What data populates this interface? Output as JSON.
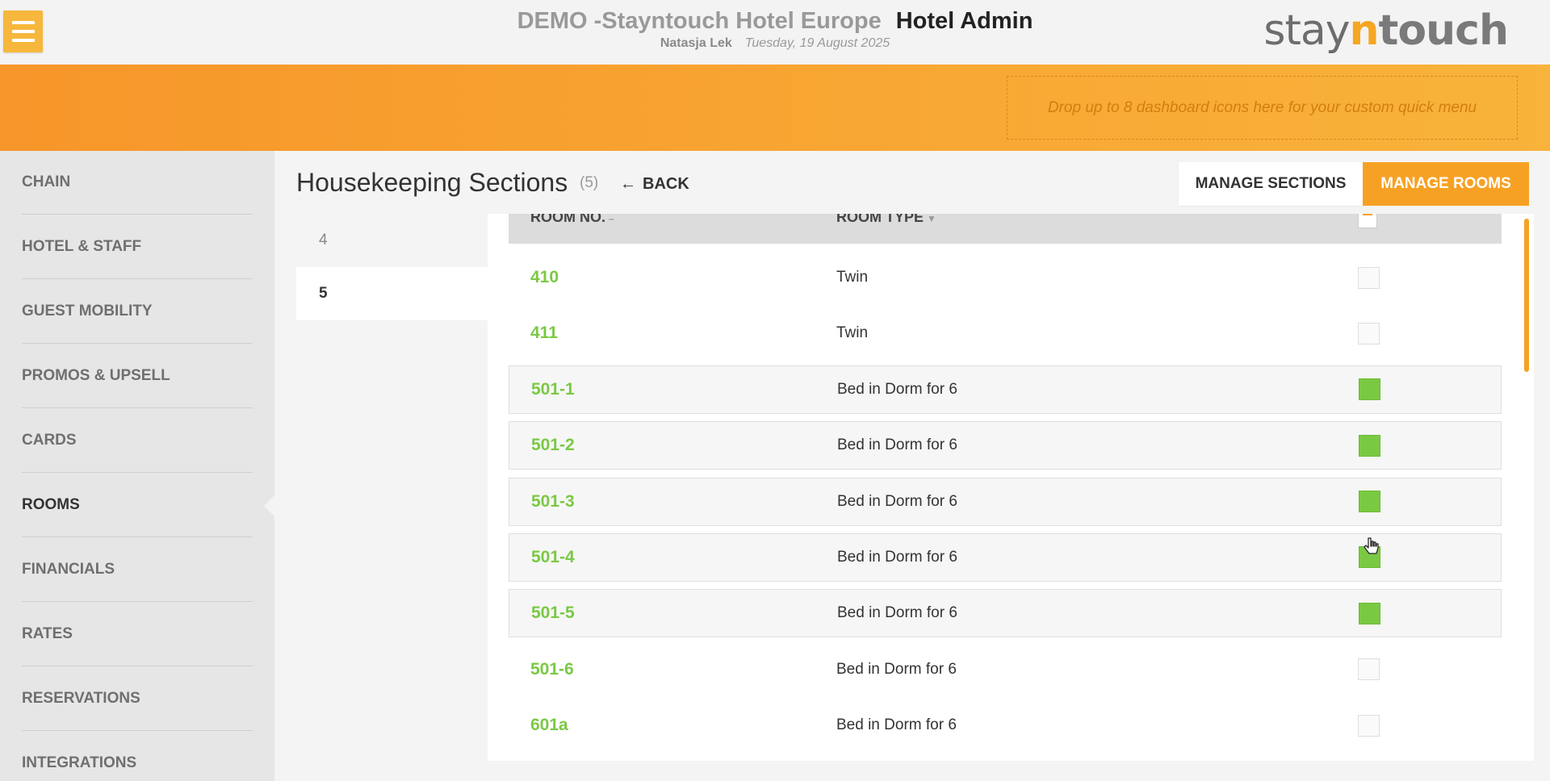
{
  "header": {
    "hotel_name": "DEMO -Stayntouch Hotel Europe",
    "app_title": "Hotel Admin",
    "user_name": "Natasja Lek",
    "date": "Tuesday, 19 August 2025",
    "logo": {
      "part1": "stay",
      "part2": "n",
      "part3": "touch"
    }
  },
  "banner": {
    "dropzone_text": "Drop up to 8 dashboard icons here for your custom quick menu"
  },
  "sidebar": {
    "items": [
      {
        "label": "CHAIN"
      },
      {
        "label": "HOTEL & STAFF"
      },
      {
        "label": "GUEST MOBILITY"
      },
      {
        "label": "PROMOS & UPSELL"
      },
      {
        "label": "CARDS"
      },
      {
        "label": "ROOMS",
        "active": true
      },
      {
        "label": "FINANCIALS"
      },
      {
        "label": "RATES"
      },
      {
        "label": "RESERVATIONS"
      },
      {
        "label": "INTEGRATIONS"
      }
    ]
  },
  "page": {
    "title": "Housekeeping Sections",
    "count": "(5)",
    "back_label": "BACK",
    "manage_sections_label": "MANAGE SECTIONS",
    "manage_rooms_label": "MANAGE ROOMS"
  },
  "sections": [
    {
      "label": "4",
      "active": false
    },
    {
      "label": "5",
      "active": true
    }
  ],
  "table": {
    "headers": {
      "room_no": "ROOM NO.",
      "room_type": "ROOM TYPE"
    },
    "rows": [
      {
        "room": "410",
        "type": "Twin",
        "checked": false
      },
      {
        "room": "411",
        "type": "Twin",
        "checked": false
      },
      {
        "room": "501-1",
        "type": "Bed in Dorm for 6",
        "checked": true
      },
      {
        "room": "501-2",
        "type": "Bed in Dorm for 6",
        "checked": true
      },
      {
        "room": "501-3",
        "type": "Bed in Dorm for 6",
        "checked": true
      },
      {
        "room": "501-4",
        "type": "Bed in Dorm for 6",
        "checked": true
      },
      {
        "room": "501-5",
        "type": "Bed in Dorm for 6",
        "checked": true
      },
      {
        "room": "501-6",
        "type": "Bed in Dorm for 6",
        "checked": false
      },
      {
        "room": "601a",
        "type": "Bed in Dorm for 6",
        "checked": false
      }
    ]
  },
  "colors": {
    "accent": "#f7a124",
    "room_link": "#7ac943",
    "checked": "#7ac943"
  }
}
